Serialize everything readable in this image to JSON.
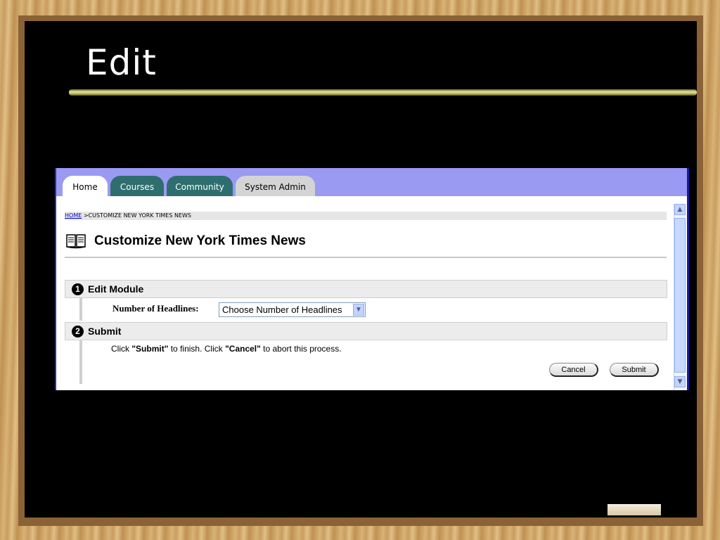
{
  "slide": {
    "title": "Edit"
  },
  "tabs": [
    {
      "label": "Home"
    },
    {
      "label": "Courses"
    },
    {
      "label": "Community"
    },
    {
      "label": "System Admin"
    }
  ],
  "breadcrumb": {
    "home": "HOME",
    "current": " >CUSTOMIZE NEW YORK TIMES NEWS"
  },
  "page": {
    "title": "Customize New York Times News",
    "icon": "book-icon"
  },
  "sections": [
    {
      "number": "1",
      "label": "Edit Module"
    },
    {
      "number": "2",
      "label": "Submit"
    }
  ],
  "form": {
    "headlines_label": "Number of Headlines:",
    "headlines_value": "Choose Number of Headlines"
  },
  "instructions": {
    "p1": "Click ",
    "submit_word": "\"Submit\"",
    "p2": " to finish. Click ",
    "cancel_word": "\"Cancel\"",
    "p3": " to abort this process."
  },
  "buttons": {
    "cancel": "Cancel",
    "submit": "Submit"
  }
}
